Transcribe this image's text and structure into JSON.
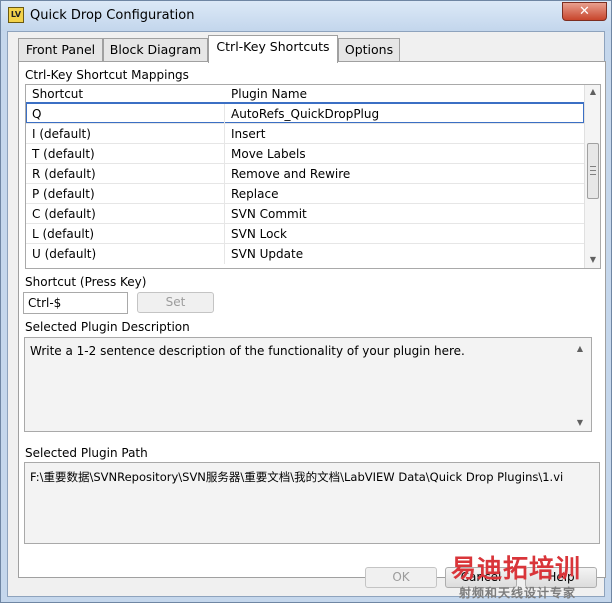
{
  "window": {
    "title": "Quick Drop Configuration",
    "close_label": "✕"
  },
  "tabs": [
    {
      "label": "Front Panel"
    },
    {
      "label": "Block Diagram"
    },
    {
      "label": "Ctrl-Key Shortcuts"
    },
    {
      "label": "Options"
    }
  ],
  "mappings": {
    "group_label": "Ctrl-Key Shortcut Mappings",
    "headers": {
      "shortcut": "Shortcut",
      "plugin": "Plugin Name"
    },
    "rows": [
      {
        "shortcut": "Q",
        "plugin": "AutoRefs_QuickDropPlug"
      },
      {
        "shortcut": "I (default)",
        "plugin": "Insert"
      },
      {
        "shortcut": "T (default)",
        "plugin": "Move Labels"
      },
      {
        "shortcut": "R (default)",
        "plugin": "Remove and Rewire"
      },
      {
        "shortcut": "P (default)",
        "plugin": "Replace"
      },
      {
        "shortcut": "C (default)",
        "plugin": "SVN Commit"
      },
      {
        "shortcut": "L (default)",
        "plugin": "SVN Lock"
      },
      {
        "shortcut": "U (default)",
        "plugin": "SVN Update"
      }
    ]
  },
  "shortcut_field": {
    "label": "Shortcut (Press Key)",
    "value": "Ctrl-$",
    "set_label": "Set"
  },
  "description": {
    "label": "Selected Plugin Description",
    "text": "Write a 1-2 sentence description of the functionality of your plugin here."
  },
  "path": {
    "label": "Selected Plugin Path",
    "text": "F:\\重要数据\\SVNRepository\\SVN服务器\\重要文档\\我的文档\\LabVIEW Data\\Quick Drop Plugins\\1.vi"
  },
  "footer": {
    "ok_label": "OK",
    "cancel_label": "Cancel",
    "help_label": "Help"
  },
  "watermark": {
    "main": "易迪拓培训",
    "sub": "射频和天线设计专家"
  }
}
